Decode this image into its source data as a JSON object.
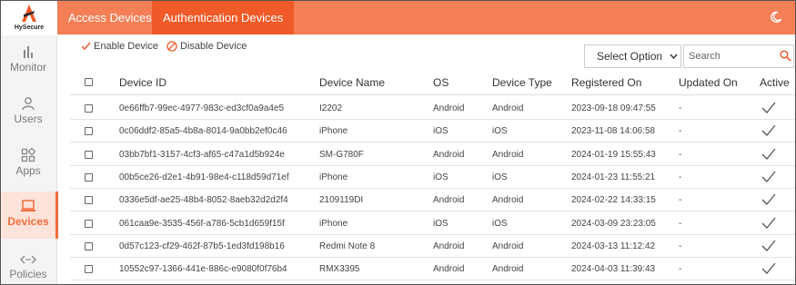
{
  "logo": {
    "text": "HySecure"
  },
  "sidebar": {
    "items": [
      {
        "label": "Monitor",
        "icon": "bar-chart-icon"
      },
      {
        "label": "Users",
        "icon": "user-icon"
      },
      {
        "label": "Apps",
        "icon": "apps-icon"
      },
      {
        "label": "Devices",
        "icon": "laptop-icon",
        "active": true
      },
      {
        "label": "Policies",
        "icon": "code-arrows-icon"
      }
    ]
  },
  "tabs": [
    {
      "label": "Access Devices"
    },
    {
      "label": "Authentication Devices",
      "active": true
    }
  ],
  "toolbar": {
    "enable_label": "Enable Device",
    "disable_label": "Disable Device",
    "select_value": "Select Option",
    "search_placeholder": "Search"
  },
  "table": {
    "headers": {
      "device_id": "Device ID",
      "device_name": "Device Name",
      "os": "OS",
      "device_type": "Device Type",
      "registered_on": "Registered On",
      "updated_on": "Updated On",
      "active": "Active"
    },
    "rows": [
      {
        "device_id": "0e66ffb7-99ec-4977-983c-ed3cf0a9a4e5",
        "device_name": "I2202",
        "os": "Android",
        "device_type": "Android",
        "registered_on": "2023-09-18 09:47:55",
        "updated_on": "-"
      },
      {
        "device_id": "0c06ddf2-85a5-4b8a-8014-9a0bb2ef0c46",
        "device_name": "iPhone",
        "os": "iOS",
        "device_type": "iOS",
        "registered_on": "2023-11-08 14:06:58",
        "updated_on": "-"
      },
      {
        "device_id": "03bb7bf1-3157-4cf3-af65-c47a1d5b924e",
        "device_name": "SM-G780F",
        "os": "Android",
        "device_type": "Android",
        "registered_on": "2024-01-19 15:55:43",
        "updated_on": "-"
      },
      {
        "device_id": "00b5ce26-d2e1-4b91-98e4-c118d59d71ef",
        "device_name": "iPhone",
        "os": "iOS",
        "device_type": "iOS",
        "registered_on": "2024-01-23 11:55:21",
        "updated_on": "-"
      },
      {
        "device_id": "0336e5df-ae25-48b4-8052-8aeb32d2d2f4",
        "device_name": "2109119DI",
        "os": "Android",
        "device_type": "Android",
        "registered_on": "2024-02-22 14:33:15",
        "updated_on": "-"
      },
      {
        "device_id": "061caa9e-3535-456f-a786-5cb1d659f15f",
        "device_name": "iPhone",
        "os": "iOS",
        "device_type": "iOS",
        "registered_on": "2024-03-09 23:23:05",
        "updated_on": "-"
      },
      {
        "device_id": "0d57c123-cf29-462f-87b5-1ed3fd198b16",
        "device_name": "Redmi Note 8",
        "os": "Android",
        "device_type": "Android",
        "registered_on": "2024-03-13 11:12:42",
        "updated_on": "-"
      },
      {
        "device_id": "10552c97-1366-441e-886c-e9080f0f76b4",
        "device_name": "RMX3395",
        "os": "Android",
        "device_type": "Android",
        "registered_on": "2024-04-03 11:39:43",
        "updated_on": "-"
      }
    ]
  },
  "colors": {
    "accent": "#f47f56",
    "accent_dark": "#f05a28",
    "active_nav_bg": "#fde3d9"
  }
}
